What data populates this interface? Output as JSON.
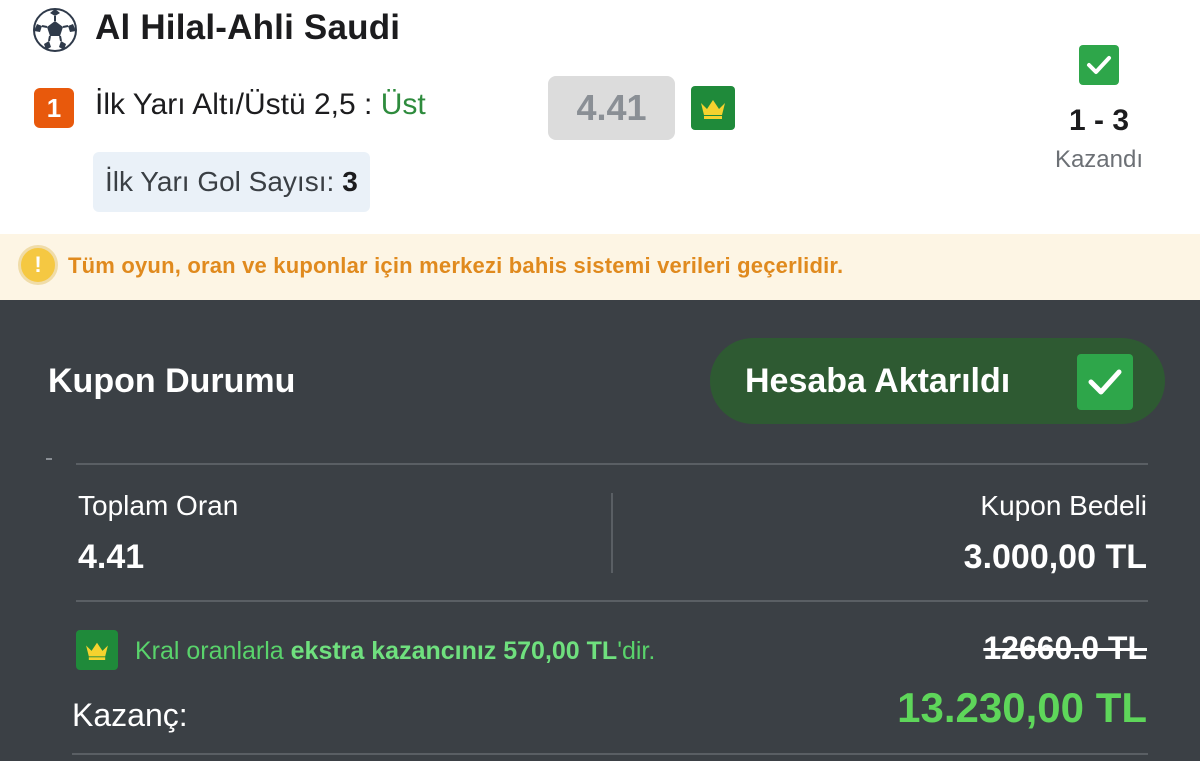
{
  "match": {
    "title": "Al Hilal-Ahli Saudi",
    "selection_number": "1",
    "market_label": "İlk Yarı Altı/Üstü 2,5 : ",
    "selection": "Üst",
    "odds": "4.41",
    "status_score": "1 - 3",
    "status_text": "Kazandı",
    "goal_count_label": "İlk Yarı Gol Sayısı:",
    "goal_count_value": "3"
  },
  "notice": {
    "text": "Tüm oyun, oran ve kuponlar için merkezi bahis sistemi verileri geçerlidir."
  },
  "coupon": {
    "title": "Kupon Durumu",
    "transfer_status": "Hesaba Aktarıldı",
    "total_odds_label": "Toplam Oran",
    "total_odds_value": "4.41",
    "stake_label": "Kupon Bedeli",
    "stake_value": "3.000,00 TL",
    "extra_prefix": "Kral oranlarla ",
    "extra_bold": "ekstra kazancınız 570,00 TL",
    "extra_suffix": "'dir.",
    "old_win": "12660.0 TL",
    "win_label": "Kazanç:",
    "win_value": "13.230,00 TL"
  },
  "colors": {
    "accent_green": "#2ea64a",
    "win_green": "#5ed65a",
    "badge_orange": "#e8590c",
    "notice_orange": "#e08a1e",
    "dark_panel": "#3b4045"
  },
  "icons": {
    "sport": "soccer-ball-icon",
    "crown": "crown-icon",
    "check": "check-icon",
    "warning": "warning-icon"
  }
}
